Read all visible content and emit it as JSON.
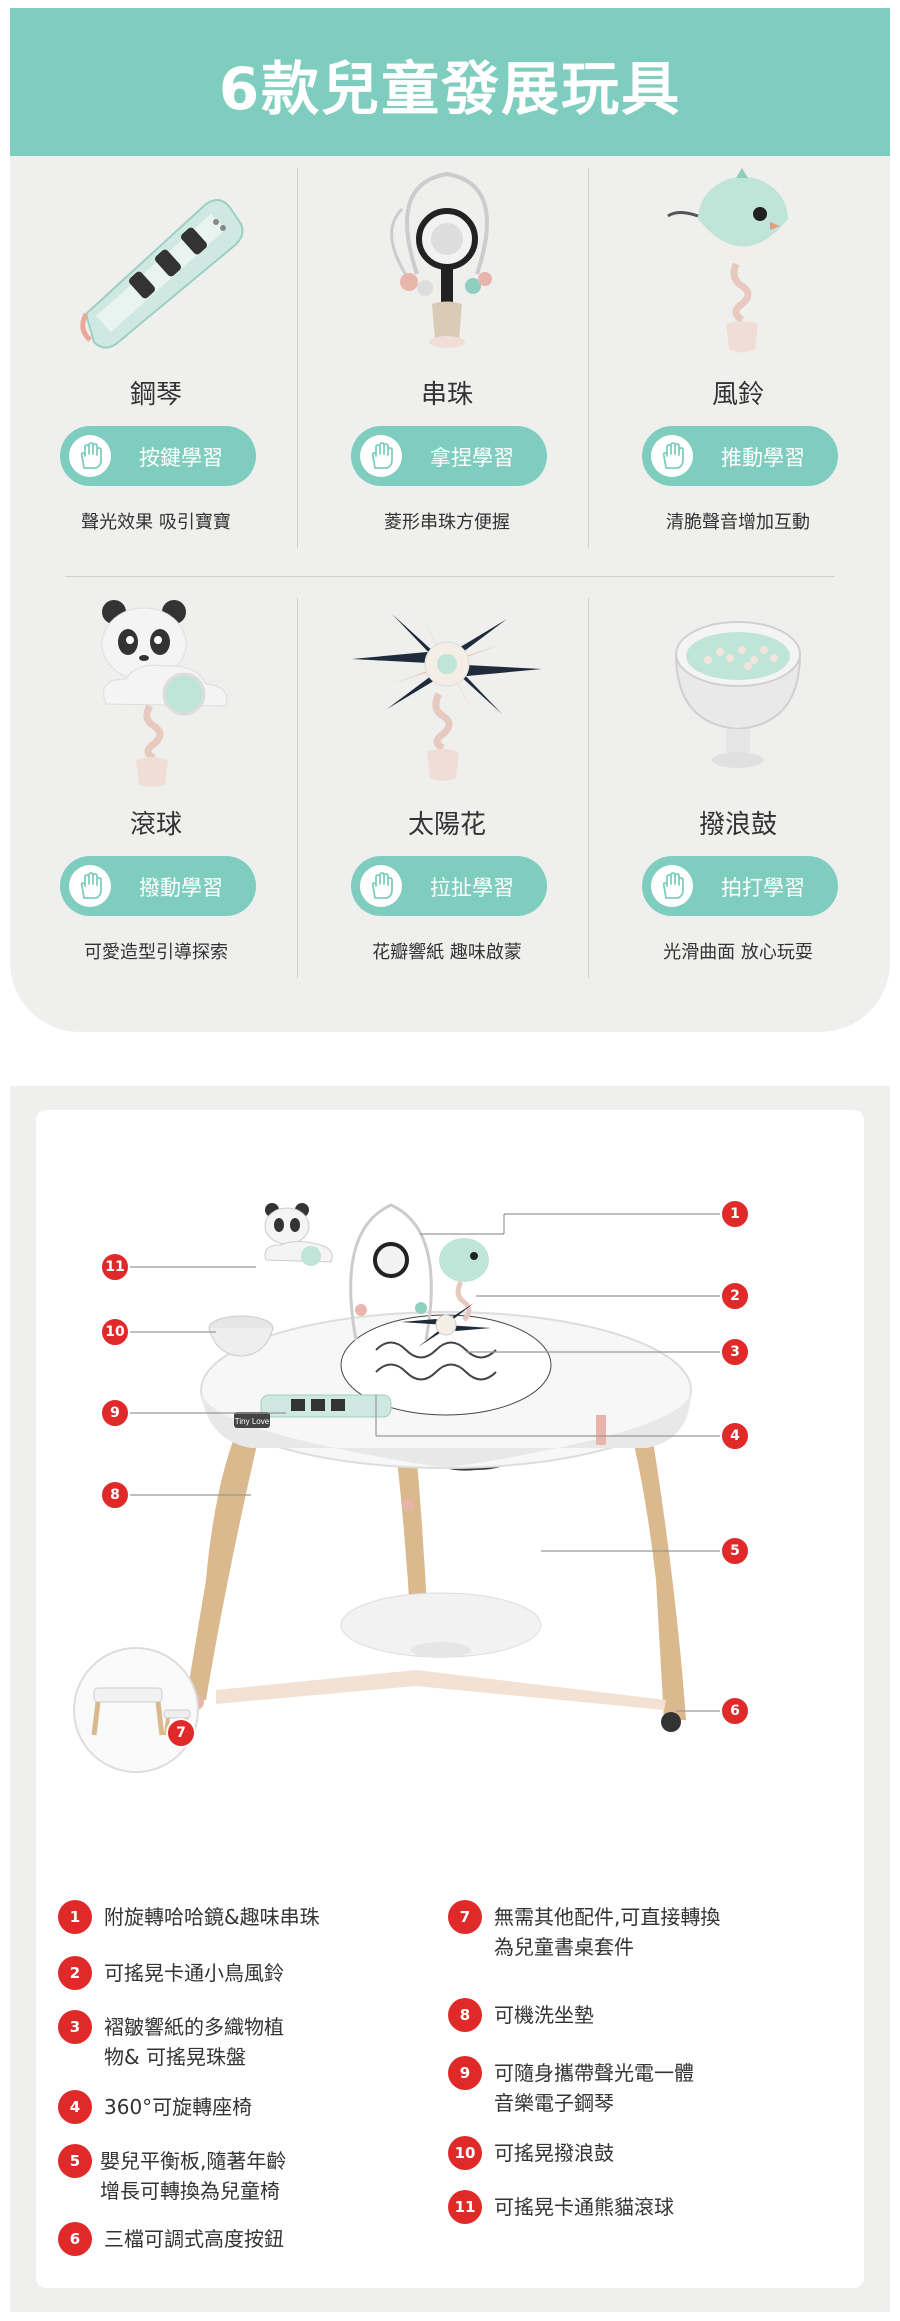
{
  "section1": {
    "title": "6款兒童發展玩具",
    "toys": [
      {
        "name": "鋼琴",
        "skill": "按鍵學習",
        "desc": "聲光效果 吸引寶寶"
      },
      {
        "name": "串珠",
        "skill": "拿捏學習",
        "desc": "菱形串珠方便握"
      },
      {
        "name": "風鈴",
        "skill": "推動學習",
        "desc": "清脆聲音增加互動"
      },
      {
        "name": "滾球",
        "skill": "撥動學習",
        "desc": "可愛造型引導探索"
      },
      {
        "name": "太陽花",
        "skill": "拉扯學習",
        "desc": "花瓣響紙 趣味啟蒙"
      },
      {
        "name": "撥浪鼓",
        "skill": "拍打學習",
        "desc": "光滑曲面 放心玩耍"
      }
    ]
  },
  "section2": {
    "product_logo": "Tiny Love",
    "callouts": [
      "1",
      "2",
      "3",
      "4",
      "5",
      "6",
      "7",
      "8",
      "9",
      "10",
      "11"
    ],
    "features": [
      {
        "num": "1",
        "text": "附旋轉哈哈鏡&趣味串珠"
      },
      {
        "num": "2",
        "text": "可搖晃卡通小鳥風鈴"
      },
      {
        "num": "3",
        "text": "褶皺響紙的多織物植物& 可搖晃珠盤"
      },
      {
        "num": "4",
        "text": "360°可旋轉座椅"
      },
      {
        "num": "5",
        "text": "嬰兒平衡板,隨著年齡增長可轉換為兒童椅"
      },
      {
        "num": "6",
        "text": "三檔可調式高度按鈕"
      },
      {
        "num": "7",
        "text": "無需其他配件,可直接轉換為兒童書桌套件"
      },
      {
        "num": "8",
        "text": "可機洗坐墊"
      },
      {
        "num": "9",
        "text": "可隨身攜帶聲光電一體音樂電子鋼琴"
      },
      {
        "num": "10",
        "text": "可搖晃撥浪鼓"
      },
      {
        "num": "11",
        "text": "可搖晃卡通熊貓滾球"
      }
    ]
  },
  "colors": {
    "mint": "#7fcdbf",
    "panel": "#efefed",
    "badge_red": "#e02a2a"
  },
  "icons": [
    "hand-icon"
  ]
}
